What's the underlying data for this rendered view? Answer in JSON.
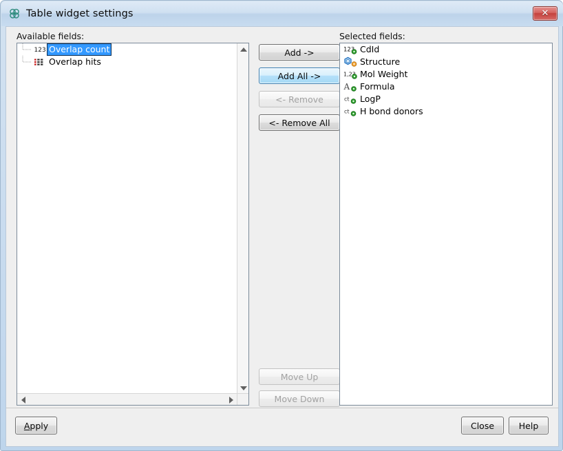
{
  "window": {
    "title": "Table widget settings",
    "app_icon": "molecule-icon",
    "close_label": "✕",
    "frame_color": "#c9dcef",
    "content_bg": "#efefef"
  },
  "labels": {
    "available": "Available fields:",
    "selected": "Selected fields:"
  },
  "available_fields": {
    "items": [
      {
        "label": "Overlap count",
        "icon": "number-123-icon",
        "selected": true
      },
      {
        "label": "Overlap hits",
        "icon": "list-grid-icon",
        "selected": false
      }
    ],
    "scroll": {
      "vertical_up": "▲",
      "vertical_down": "▼",
      "horizontal_left": "◀",
      "horizontal_right": "▶"
    }
  },
  "selected_fields": {
    "items": [
      {
        "label": "CdId",
        "icon": "number-123-field-icon",
        "badge_color": "#2f9e2f"
      },
      {
        "label": "Structure",
        "icon": "structure-field-icon",
        "badge_color": "#f0a030"
      },
      {
        "label": "Mol Weight",
        "icon": "decimal-number-field-icon",
        "badge_color": "#2f9e2f"
      },
      {
        "label": "Formula",
        "icon": "text-field-icon",
        "badge_color": "#2f9e2f"
      },
      {
        "label": "LogP",
        "icon": "ct-field-icon",
        "badge_color": "#2f9e2f"
      },
      {
        "label": "H bond donors",
        "icon": "ct-field-icon",
        "badge_color": "#2f9e2f"
      }
    ]
  },
  "transfer_buttons": [
    {
      "id": "add",
      "label": "Add ->",
      "state": "normal"
    },
    {
      "id": "add_all",
      "label": "Add All ->",
      "state": "hover"
    },
    {
      "id": "remove",
      "label": "<- Remove",
      "state": "disabled"
    },
    {
      "id": "remove_all",
      "label": "<- Remove All",
      "state": "normal"
    }
  ],
  "order_buttons": [
    {
      "id": "move_up",
      "label": "Move Up",
      "state": "disabled"
    },
    {
      "id": "move_down",
      "label": "Move Down",
      "state": "disabled"
    }
  ],
  "dialog_buttons": {
    "apply_prefix": "A",
    "apply_rest": "pply",
    "close": "Close",
    "help": "Help"
  },
  "colors": {
    "selection_blue": "#3399ff",
    "hover_blue": "#b4e0fa",
    "close_red": "#c4413d",
    "badge_green": "#2f9e2f",
    "badge_orange": "#f0a030"
  }
}
